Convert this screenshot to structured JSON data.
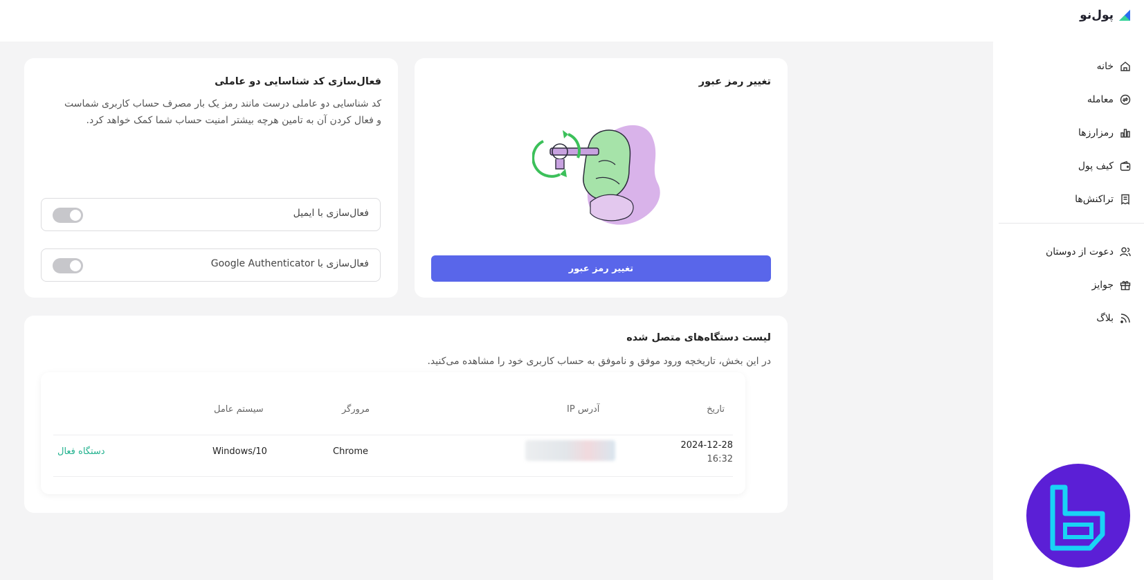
{
  "header": {
    "logo_text": "پول‌نو",
    "logo_icon": "poolno-logo-icon"
  },
  "sidebar": {
    "items": [
      {
        "label": "خانه",
        "icon": "home-icon"
      },
      {
        "label": "معامله",
        "icon": "exchange-icon"
      },
      {
        "label": "رمزارزها",
        "icon": "chart-bars-icon"
      },
      {
        "label": "کیف پول",
        "icon": "wallet-icon"
      },
      {
        "label": "تراکنش‌ها",
        "icon": "receipt-icon"
      }
    ],
    "secondary_items": [
      {
        "label": "دعوت از دوستان",
        "icon": "users-icon"
      },
      {
        "label": "جوایز",
        "icon": "gift-icon"
      },
      {
        "label": "بلاگ",
        "icon": "rss-icon"
      }
    ]
  },
  "change_password": {
    "title": "تغییر رمز عبور",
    "button_label": "تغییر رمز عبور",
    "illustration": "key-hand-illustration"
  },
  "two_factor": {
    "title": "فعال‌سازی کد شناسایی دو عاملی",
    "description_line1": "کد شناسایی دو عاملی درست مانند رمز یک بار مصرف حساب کاربری شماست",
    "description_line2": "و فعال کردن آن به تامین هرچه بیشتر امنیت حساب شما کمک خواهد کرد.",
    "options": [
      {
        "label": "فعال‌سازی با ایمیل",
        "enabled": false
      },
      {
        "label": "فعال‌سازی با Google Authenticator",
        "enabled": false
      }
    ]
  },
  "devices": {
    "title": "لیست دستگاه‌های متصل شده",
    "description": "در این بخش، تاریخچه ورود موفق و ناموفق به حساب کاربری خود را مشاهده می‌کنید.",
    "columns": {
      "date": "تاریخ",
      "ip": "آدرس IP",
      "browser": "مرورگر",
      "os": "سیستم عامل"
    },
    "rows": [
      {
        "date": "2024-12-28",
        "time": "16:32",
        "ip": "",
        "browser": "Chrome",
        "os": "Windows/10",
        "status": "دستگاه فعال"
      }
    ]
  },
  "colors": {
    "primary": "#5966ea",
    "status_active": "#23b28f",
    "badge": "#5b1fd6",
    "badge_accent": "#19d3f5"
  }
}
